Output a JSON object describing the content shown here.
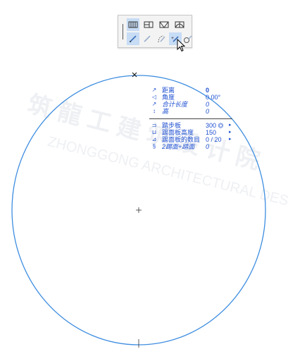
{
  "toolbar": {
    "buttons_row1": [
      {
        "name": "stair-straight-icon",
        "active": true
      },
      {
        "name": "stair-landing-icon",
        "active": false
      },
      {
        "name": "stair-winder-icon",
        "active": false
      },
      {
        "name": "stair-curved-icon",
        "active": false
      }
    ],
    "buttons_row2": [
      {
        "name": "pen-polyline-icon",
        "active": true
      },
      {
        "name": "pen-line-disabled-icon",
        "active": false
      },
      {
        "name": "pen-arc-icon",
        "active": false
      },
      {
        "name": "pen-circle-icon",
        "active": true
      },
      {
        "name": "pen-center-radius-icon",
        "active": false
      }
    ]
  },
  "tracker": {
    "rows": [
      {
        "icon": "↗",
        "label": "距离",
        "value": "0",
        "value_style": "bold"
      },
      {
        "icon": "◁",
        "label": "角度",
        "value": "0.00°",
        "value_style": "normal"
      },
      {
        "icon": "↗",
        "label": "合计长度",
        "value": "0",
        "value_style": "italic",
        "label_style": "italic"
      },
      {
        "icon": "↕",
        "label": "高",
        "value": "0",
        "value_style": "italic",
        "label_style": "italic"
      }
    ],
    "rows2": [
      {
        "icon": "⊐",
        "label": "踏步板",
        "value": "300 ⏣",
        "arrow": "▸"
      },
      {
        "icon": "⊔",
        "label": "踢面板高度",
        "value": "150",
        "arrow": "▸"
      },
      {
        "icon": "⊿",
        "label": "踢面板的数目",
        "value": "0 / 20",
        "arrow": "▸"
      },
      {
        "icon": "§",
        "label": "2踢面+踏面",
        "value": "0",
        "value_style": "italic",
        "label_style": "italic"
      }
    ]
  },
  "watermark": {
    "line1": "筑 龍 工 建 筑 设 计 院",
    "line2": "ZHONGGONG ARCHITECTURAL DESIGN"
  },
  "colors": {
    "circle": "#3d8de0",
    "tracker_text": "#1e4fd0"
  }
}
